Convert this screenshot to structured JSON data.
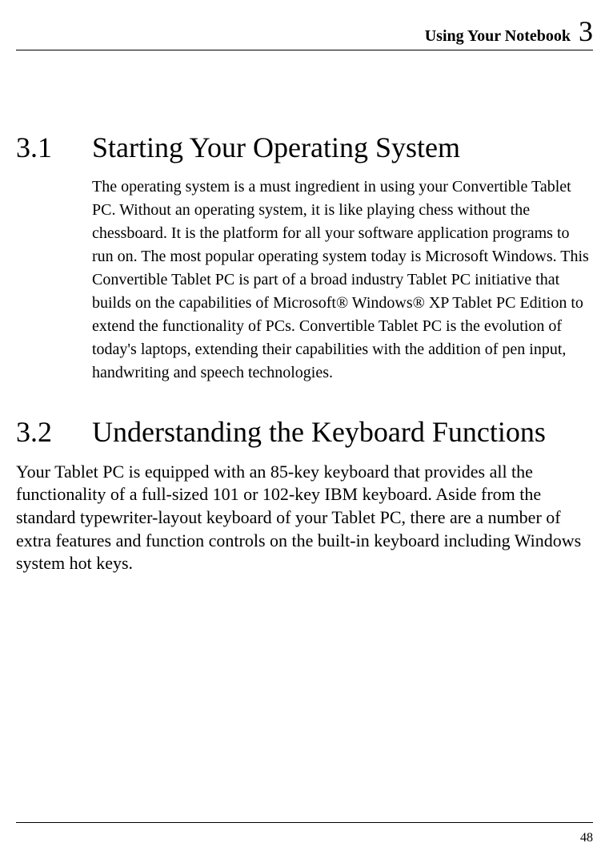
{
  "header": {
    "title": "Using Your Notebook",
    "chapter_number": "3"
  },
  "sections": [
    {
      "number": "3.1",
      "title": "Starting Your Operating System",
      "body": "The operating system is a must ingredient in using your Convertible Tablet PC. Without an operating system, it is like playing chess without the chessboard. It is the platform for all your software application programs to run on. The most popular operating system today is Microsoft Windows. This Convertible Tablet PC is part of a broad industry Tablet PC initiative that builds on the capabilities of Microsoft® Windows® XP Tablet PC Edition to extend the functionality of PCs. Convertible Tablet PC is the evolution of today's laptops, extending their capabilities with the addition of pen input, handwriting and speech technologies."
    },
    {
      "number": "3.2",
      "title": "Understanding the Keyboard Functions",
      "body": "Your Tablet PC is equipped with an 85-key keyboard that provides all the functionality of a full-sized 101 or 102-key IBM keyboard. Aside from the standard typewriter-layout keyboard of your Tablet PC, there are a number of extra features and function controls on the built-in keyboard including Windows system hot keys."
    }
  ],
  "footer": {
    "page_number": "48"
  }
}
